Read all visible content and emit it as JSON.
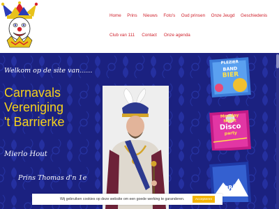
{
  "nav": {
    "row1": [
      "Home",
      "Prins",
      "Nieuws",
      "Foto's",
      "Oud prinsen",
      "Onze Jeugd",
      "Geschiedenis"
    ],
    "row2": [
      "Club van 111",
      "Contact",
      "Onze agenda"
    ]
  },
  "hero": {
    "welcome": "Welkom op de site van......",
    "club_line1": "Carnavals",
    "club_line2": "Vereniging",
    "club_line3": "'t Barrierke",
    "location": "Mierlo Hout",
    "prince": "Prins Thomas d'n 1e"
  },
  "flyers": {
    "f1_line1": "PLEZIER",
    "f1_line2": "BAND",
    "f1_line3": "BIER",
    "f2_line1": "Monday",
    "f2_line2": "Night",
    "f2_line3": "Disco",
    "f2_line4": "party",
    "f3_line1": "APRÈS"
  },
  "cookie": {
    "text": "Wij gebruiken cookies op deze website om een goede werking te garanderen.",
    "accept": "Accepteren"
  },
  "colors": {
    "nav_text": "#cf1f2a",
    "hero_bg": "#1b2180",
    "club_name": "#f6d21c",
    "accept_button": "#f5b400"
  }
}
